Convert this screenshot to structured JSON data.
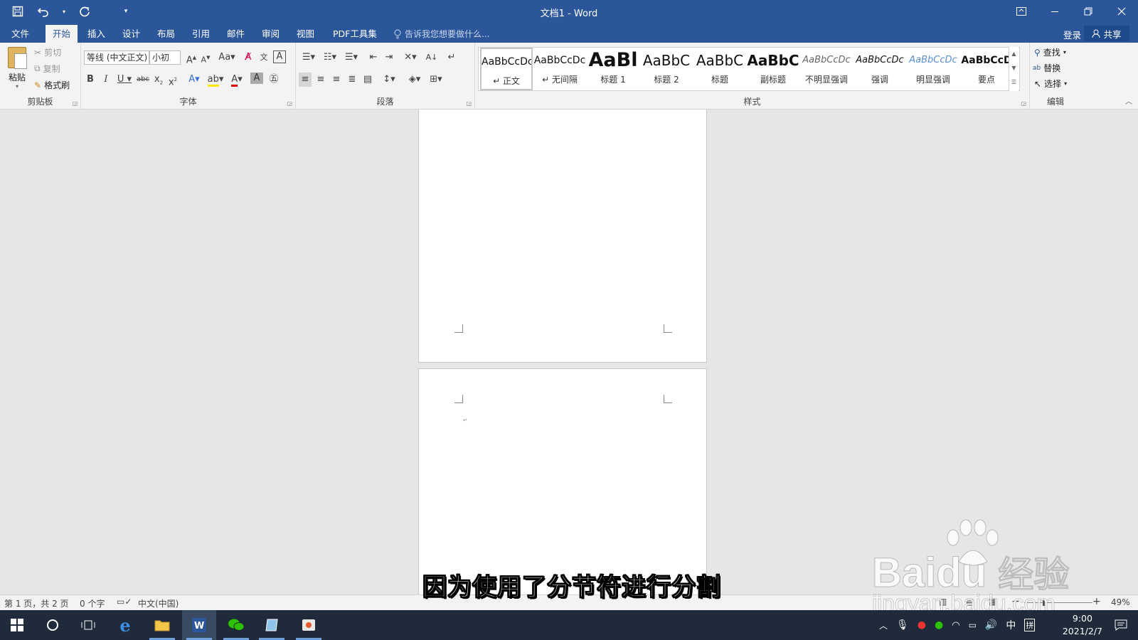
{
  "window": {
    "title": "文档1 - Word",
    "controls": [
      "ribbon-display-icon",
      "minimize-icon",
      "restore-icon",
      "close-icon"
    ]
  },
  "tabs": [
    {
      "label": "文件",
      "active": false
    },
    {
      "label": "开始",
      "active": true
    },
    {
      "label": "插入",
      "active": false
    },
    {
      "label": "设计",
      "active": false
    },
    {
      "label": "布局",
      "active": false
    },
    {
      "label": "引用",
      "active": false
    },
    {
      "label": "邮件",
      "active": false
    },
    {
      "label": "审阅",
      "active": false
    },
    {
      "label": "视图",
      "active": false
    },
    {
      "label": "PDF工具集",
      "active": false
    }
  ],
  "tell_me": "告诉我您想要做什么...",
  "login": "登录",
  "share": "共享",
  "ribbon": {
    "clipboard": {
      "paste": "粘贴",
      "cut": "剪切",
      "copy": "复制",
      "format_painter": "格式刷",
      "label": "剪贴板"
    },
    "font": {
      "font_name": "等线 (中文正文)",
      "font_size": "小初",
      "label": "字体"
    },
    "paragraph": {
      "label": "段落"
    },
    "styles": {
      "label": "样式",
      "items": [
        {
          "preview": "AaBbCcDc",
          "name": "↵ 正文"
        },
        {
          "preview": "AaBbCcDc",
          "name": "↵ 无间隔"
        },
        {
          "preview": "AaBl",
          "name": "标题 1"
        },
        {
          "preview": "AaBbC",
          "name": "标题 2"
        },
        {
          "preview": "AaBbC",
          "name": "标题"
        },
        {
          "preview": "AaBbC",
          "name": "副标题"
        },
        {
          "preview": "AaBbCcDc",
          "name": "不明显强调"
        },
        {
          "preview": "AaBbCcDc",
          "name": "强调"
        },
        {
          "preview": "AaBbCcDc",
          "name": "明显强调"
        },
        {
          "preview": "AaBbCcD",
          "name": "要点"
        }
      ]
    },
    "editing": {
      "find": "查找",
      "replace": "替换",
      "select": "选择",
      "label": "编辑"
    }
  },
  "status": {
    "page": "第 1 页，共 2 页",
    "words": "0 个字",
    "language": "中文(中国)",
    "zoom": "49%"
  },
  "subtitle": "因为使用了分节符进行分割",
  "watermark": {
    "brand": "Bai",
    "brand2": "du",
    "cn": "经验",
    "url": "jingyan.baidu.com"
  },
  "taskbar": {
    "time": "9:00",
    "date": "2021/2/7",
    "ime": "中",
    "ime2": "拼"
  },
  "colors": {
    "accent": "#2b579a",
    "ribbon": "#f3f3f3",
    "workspace": "#e6e6e6"
  }
}
